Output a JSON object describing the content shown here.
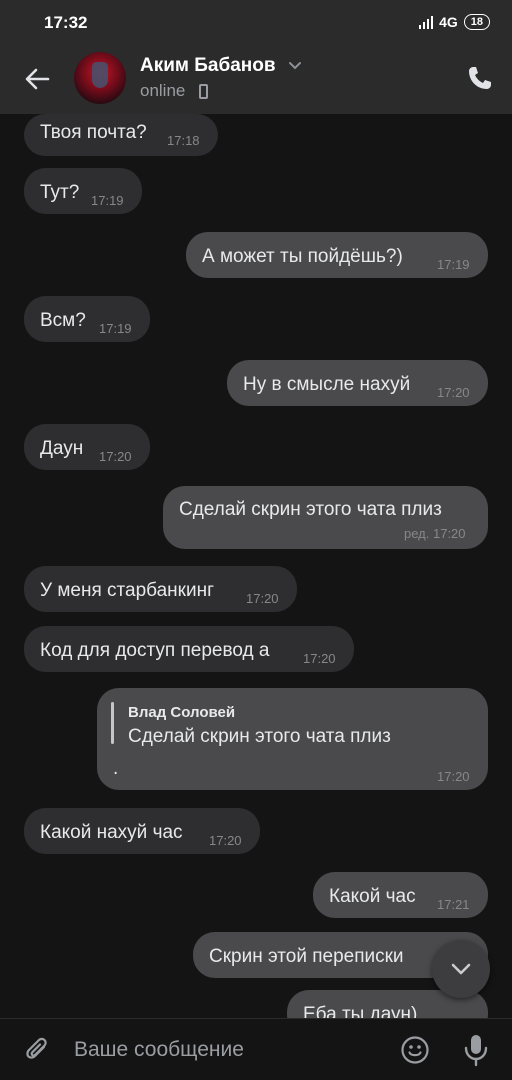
{
  "status_bar": {
    "time": "17:32",
    "network": "4G",
    "battery": "18"
  },
  "header": {
    "contact_name": "Аким Бабанов",
    "contact_status": "online"
  },
  "messages": [
    {
      "direction": "in",
      "text": "Твоя почта?",
      "time": "17:18"
    },
    {
      "direction": "in",
      "text": "Тут?",
      "time": "17:19"
    },
    {
      "direction": "out",
      "text": "А может ты пойдёшь?)",
      "time": "17:19"
    },
    {
      "direction": "in",
      "text": "Всм?",
      "time": "17:19"
    },
    {
      "direction": "out",
      "text": "Ну в смысле нахуй",
      "time": "17:20"
    },
    {
      "direction": "in",
      "text": "Даун",
      "time": "17:20"
    },
    {
      "direction": "out",
      "text": "Сделай скрин этого чата плиз",
      "time": "ред. 17:20"
    },
    {
      "direction": "in",
      "text": "У меня старбанкинг",
      "time": "17:20"
    },
    {
      "direction": "in",
      "text": "Код для доступ перевод а",
      "time": "17:20"
    },
    {
      "direction": "out",
      "reply_author": "Влад Соловей",
      "reply_text": "Сделай скрин этого чата плиз",
      "text": ".",
      "time": "17:20"
    },
    {
      "direction": "in",
      "text": "Какой нахуй час",
      "time": "17:20"
    },
    {
      "direction": "out",
      "text": "Какой час",
      "time": "17:21"
    },
    {
      "direction": "out",
      "text": "Скрин этой переписки",
      "time": ""
    },
    {
      "direction": "out",
      "text": "Еба ты даун)",
      "time": ""
    }
  ],
  "composer": {
    "placeholder": "Ваше сообщение"
  },
  "icons": {
    "back": "arrow-left-icon",
    "call": "phone-icon",
    "attach": "paperclip-icon",
    "emoji": "smiley-icon",
    "voice": "microphone-icon",
    "scroll": "chevron-down-icon"
  },
  "colors": {
    "background": "#141414",
    "header": "#2b2b2b",
    "incoming_bubble": "#2e2e30",
    "outgoing_bubble": "#4a4a4c"
  }
}
